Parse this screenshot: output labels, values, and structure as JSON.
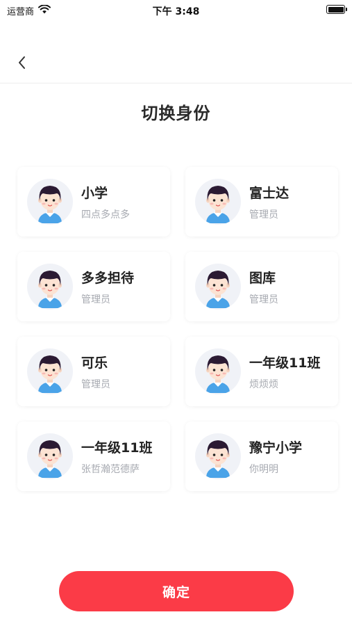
{
  "status_bar": {
    "carrier": "运营商",
    "time": "下午 3:48"
  },
  "header": {
    "title": "切换身份"
  },
  "identities": [
    {
      "name": "小学",
      "role": "四点多点多"
    },
    {
      "name": "富士达",
      "role": "管理员"
    },
    {
      "name": "多多担待",
      "role": "管理员"
    },
    {
      "name": "图库",
      "role": "管理员"
    },
    {
      "name": "可乐",
      "role": "管理员"
    },
    {
      "name": "一年级11班",
      "role": "烦烦烦"
    },
    {
      "name": "一年级11班",
      "role": "张哲瀚范德萨"
    },
    {
      "name": "豫宁小学",
      "role": "你明明"
    }
  ],
  "footer": {
    "confirm_label": "确定"
  },
  "colors": {
    "accent": "#fb3b47",
    "secondary_text": "#a6a9b0",
    "avatar_bg": "#f0f2f7",
    "shirt": "#4aa3e8",
    "hair": "#2b1a33"
  }
}
